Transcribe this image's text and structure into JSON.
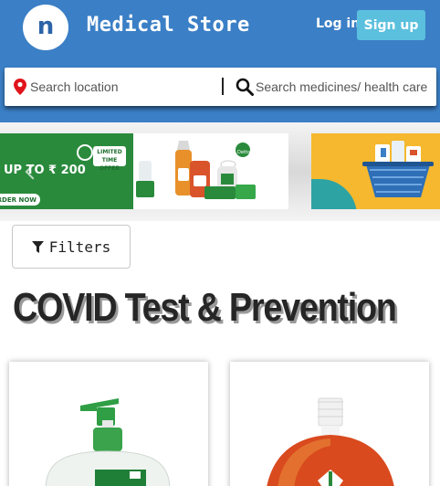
{
  "header": {
    "logo_letter": "n",
    "brand": "Medical Store",
    "login_label": "Log in",
    "signup_label": "Sign up"
  },
  "search": {
    "location_placeholder": "Search location",
    "medicine_placeholder": "Search medicines/ health care"
  },
  "banners": {
    "offer_text": "UP TO ₹ 200",
    "order_label": "ORDER NOW",
    "limited_label": "LIMITED TIME OFFER",
    "brand_label": "Dettol"
  },
  "filters": {
    "label": "Filters"
  },
  "section": {
    "title": "COVID Test & Prevention"
  },
  "products": [
    {
      "image": "hand-wash-bottle"
    },
    {
      "image": "antiseptic-liquid-bottle"
    }
  ],
  "colors": {
    "header_bg": "#3b7fc6",
    "signup_bg": "#5bc0de",
    "location_pin": "#e0141c",
    "banner_green": "#2a8a3c",
    "banner_yellow": "#f5b82e"
  },
  "icons": [
    "location-pin-icon",
    "search-icon",
    "filter-icon",
    "chevron-left-icon"
  ]
}
